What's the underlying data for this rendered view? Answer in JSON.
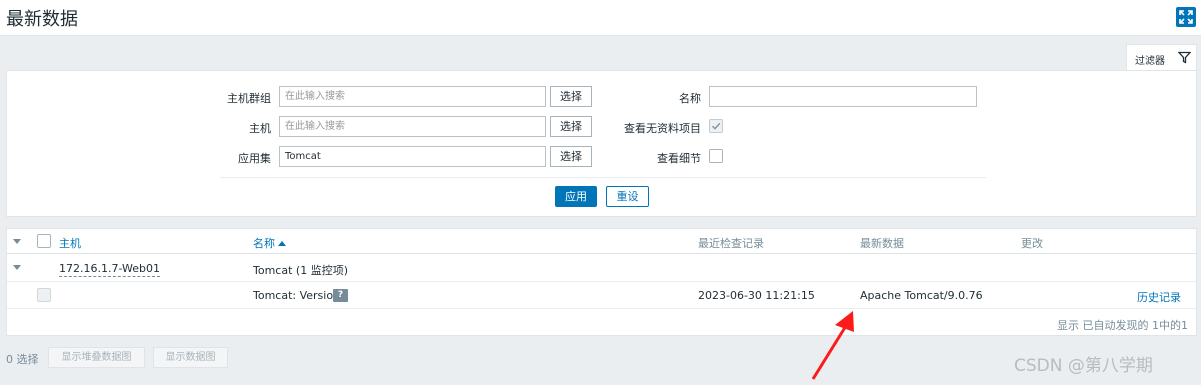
{
  "header": {
    "title": "最新数据"
  },
  "filter_tab": {
    "label": "过滤器"
  },
  "filter": {
    "host_groups_label": "主机群组",
    "host_groups_placeholder": "在此输入搜索",
    "host_groups_select": "选择",
    "hosts_label": "主机",
    "hosts_placeholder": "在此输入搜索",
    "hosts_select": "选择",
    "application_label": "应用集",
    "application_value": "Tomcat",
    "application_select": "选择",
    "name_label": "名称",
    "name_value": "",
    "show_without_data_label": "查看无资料项目",
    "show_without_data_checked": true,
    "show_details_label": "查看细节",
    "show_details_checked": false,
    "apply_label": "应用",
    "reset_label": "重设"
  },
  "table": {
    "columns": {
      "host": "主机",
      "name": "名称",
      "last_check": "最近检查记录",
      "last_value": "最新数据",
      "change": "更改"
    },
    "group_row": {
      "host": "172.16.1.7-Web01",
      "app_name": "Tomcat",
      "app_count": " (1 监控项)"
    },
    "item_row": {
      "name": "Tomcat: Version",
      "help": "?",
      "last_check": "2023-06-30 11:21:15",
      "last_value": "Apache Tomcat/9.0.76",
      "change": "",
      "history_link": "历史记录"
    },
    "footer": "显示 已自动发现的 1中的1"
  },
  "bottom": {
    "selected_count": "0 选择",
    "stacked_graph_button": "显示堆叠数据图",
    "graph_button": "显示数据图"
  },
  "watermark": "CSDN @第八学期",
  "colors": {
    "accent": "#0275b8",
    "annotation_arrow": "#ff1a1a"
  },
  "icons": {
    "fullscreen": "fullscreen-icon",
    "filter": "funnel-icon",
    "help": "question-icon",
    "collapse": "caret-down-icon",
    "sort": "sort-asc-icon"
  }
}
